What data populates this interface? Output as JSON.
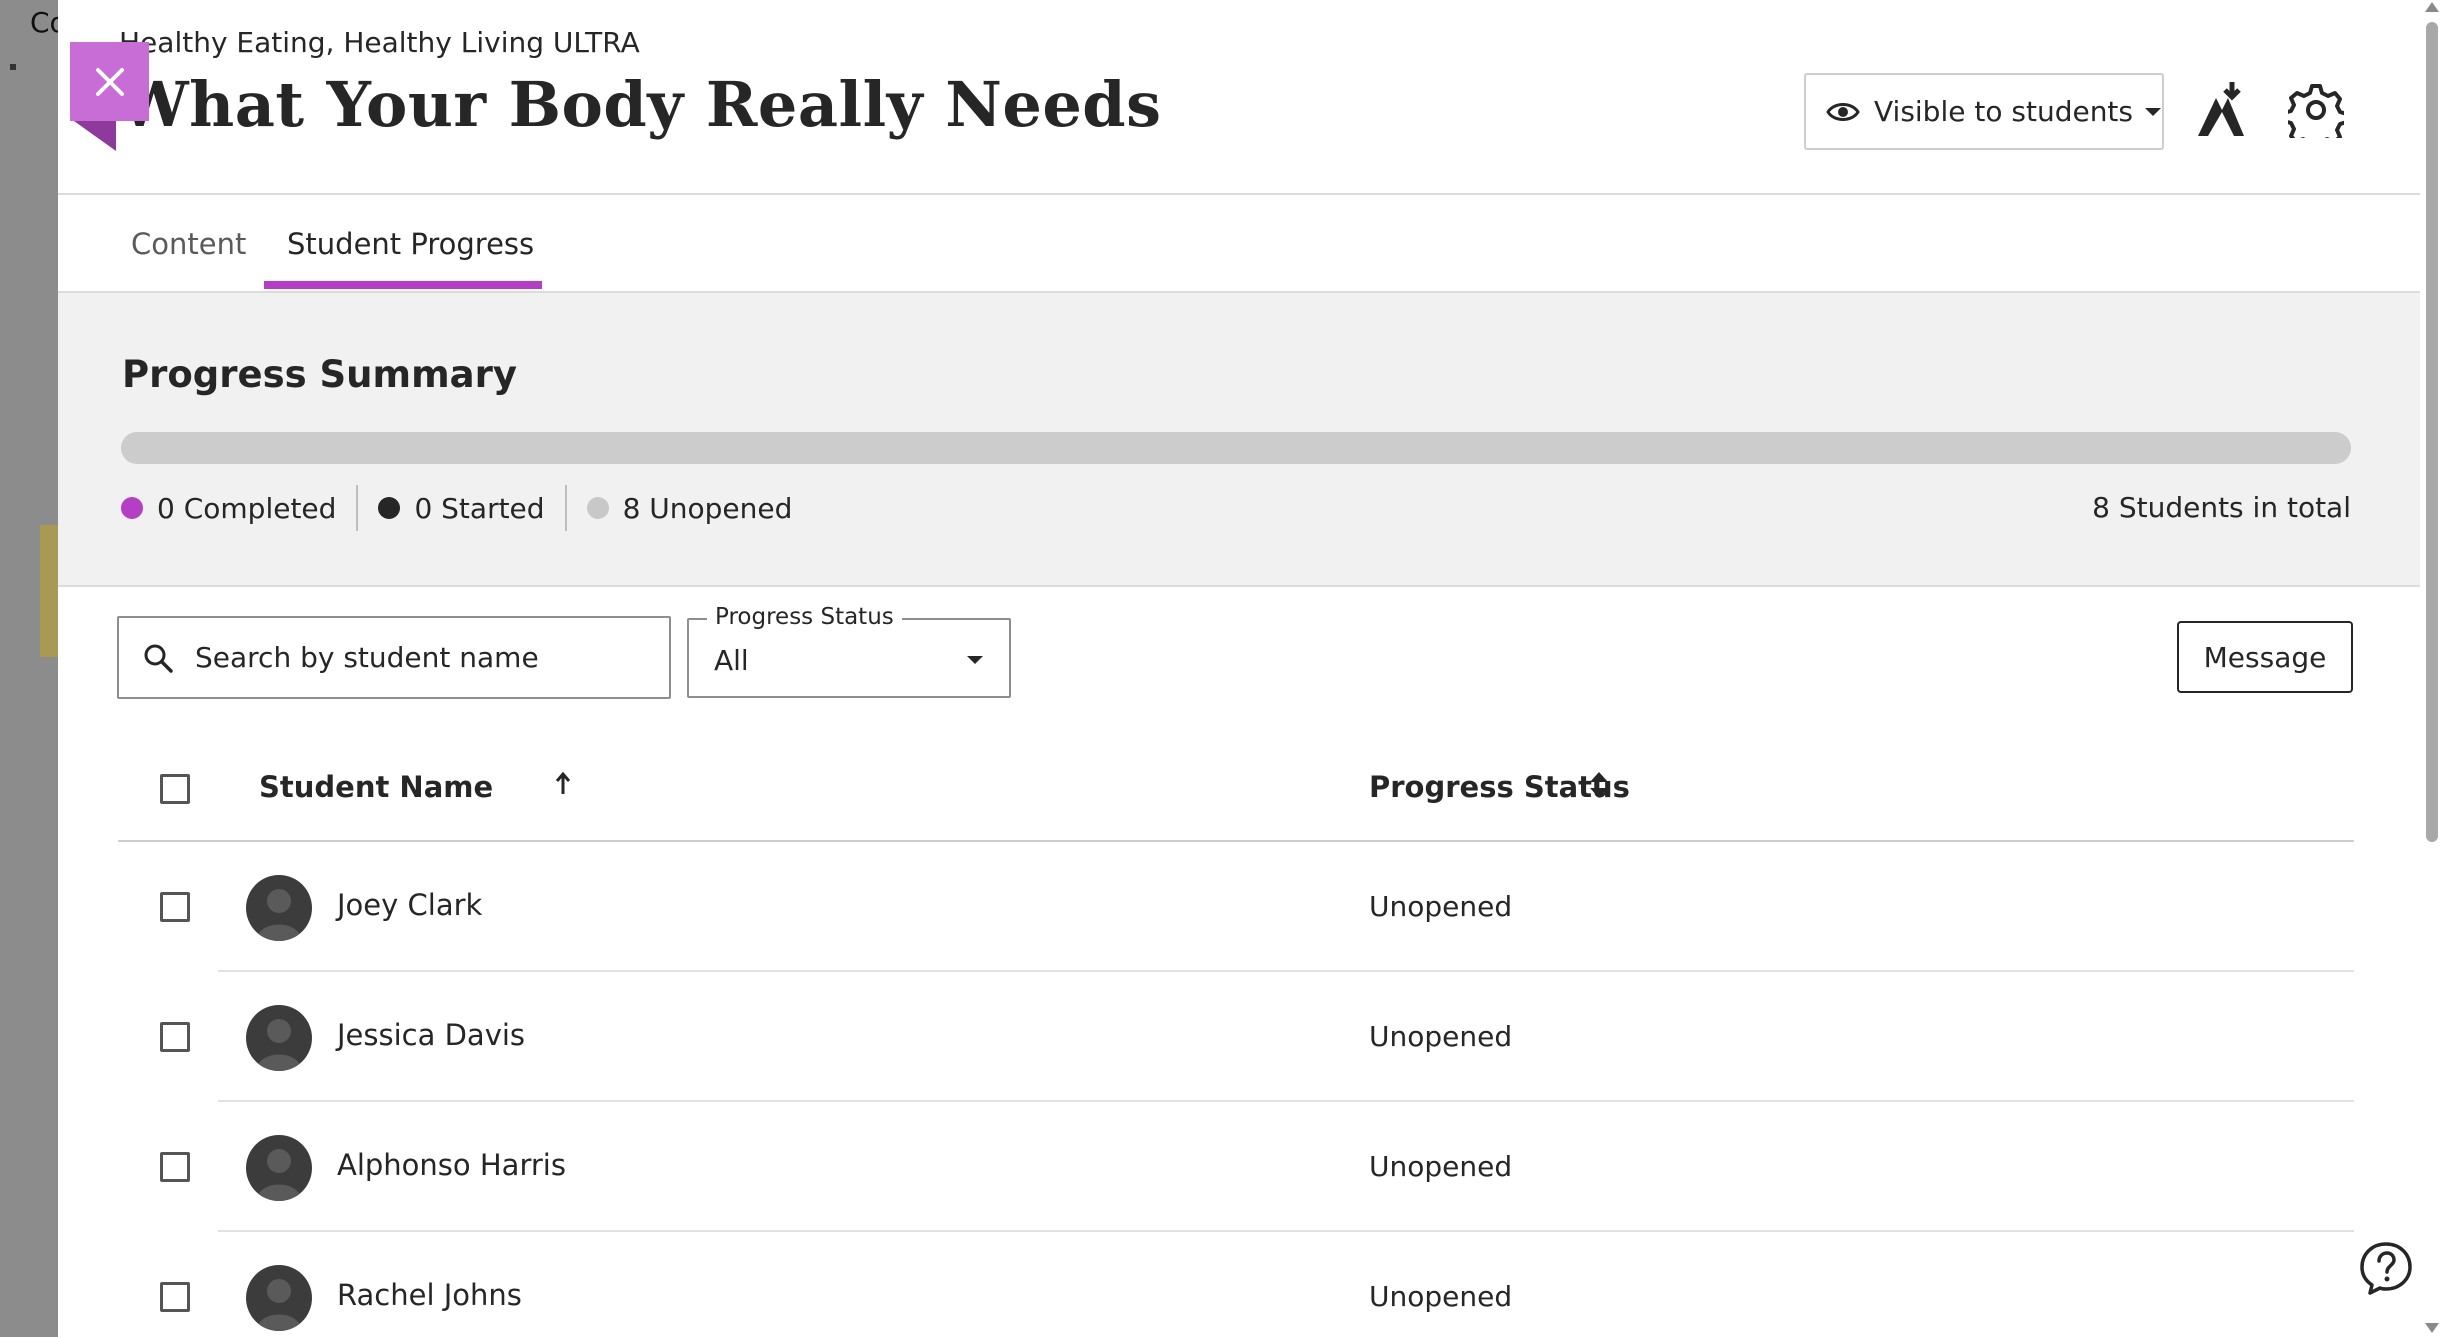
{
  "background": {
    "visible_text": "Co"
  },
  "close_button": {
    "label": "Close"
  },
  "header": {
    "course_name": "Healthy Eating, Healthy Living ULTRA",
    "title": "What Your Body Really Needs",
    "visibility": {
      "label": "Visible to students",
      "icon": "eye-icon"
    },
    "actions": [
      {
        "icon": "ally-download-icon"
      },
      {
        "icon": "gear-icon"
      }
    ]
  },
  "tabs": [
    {
      "label": "Content",
      "selected": false
    },
    {
      "label": "Student Progress",
      "selected": true
    }
  ],
  "summary": {
    "heading": "Progress Summary",
    "progress": {
      "completed_fraction": 0,
      "started_fraction": 0
    },
    "legend": [
      {
        "label": "0 Completed",
        "color": "#b43fc5"
      },
      {
        "label": "0 Started",
        "color": "#262626"
      },
      {
        "label": "8 Unopened",
        "color": "#c8c8c8"
      }
    ],
    "total": "8 Students in total"
  },
  "controls": {
    "search": {
      "placeholder": "Search by student name",
      "value": "",
      "icon": "search-icon"
    },
    "status_filter": {
      "label": "Progress Status",
      "value": "All"
    },
    "message_button": "Message"
  },
  "table": {
    "columns": {
      "name": "Student Name",
      "status": "Progress Status"
    },
    "sort": {
      "column": "name",
      "direction": "ascending"
    },
    "rows": [
      {
        "name": "Joey Clark",
        "status": "Unopened"
      },
      {
        "name": "Jessica Davis",
        "status": "Unopened"
      },
      {
        "name": "Alphonso Harris",
        "status": "Unopened"
      },
      {
        "name": "Rachel Johns",
        "status": "Unopened"
      }
    ]
  },
  "colors": {
    "accent": "#b43fc5",
    "close_button": "#c86cd6",
    "summary_bg": "#f1f1f1"
  }
}
